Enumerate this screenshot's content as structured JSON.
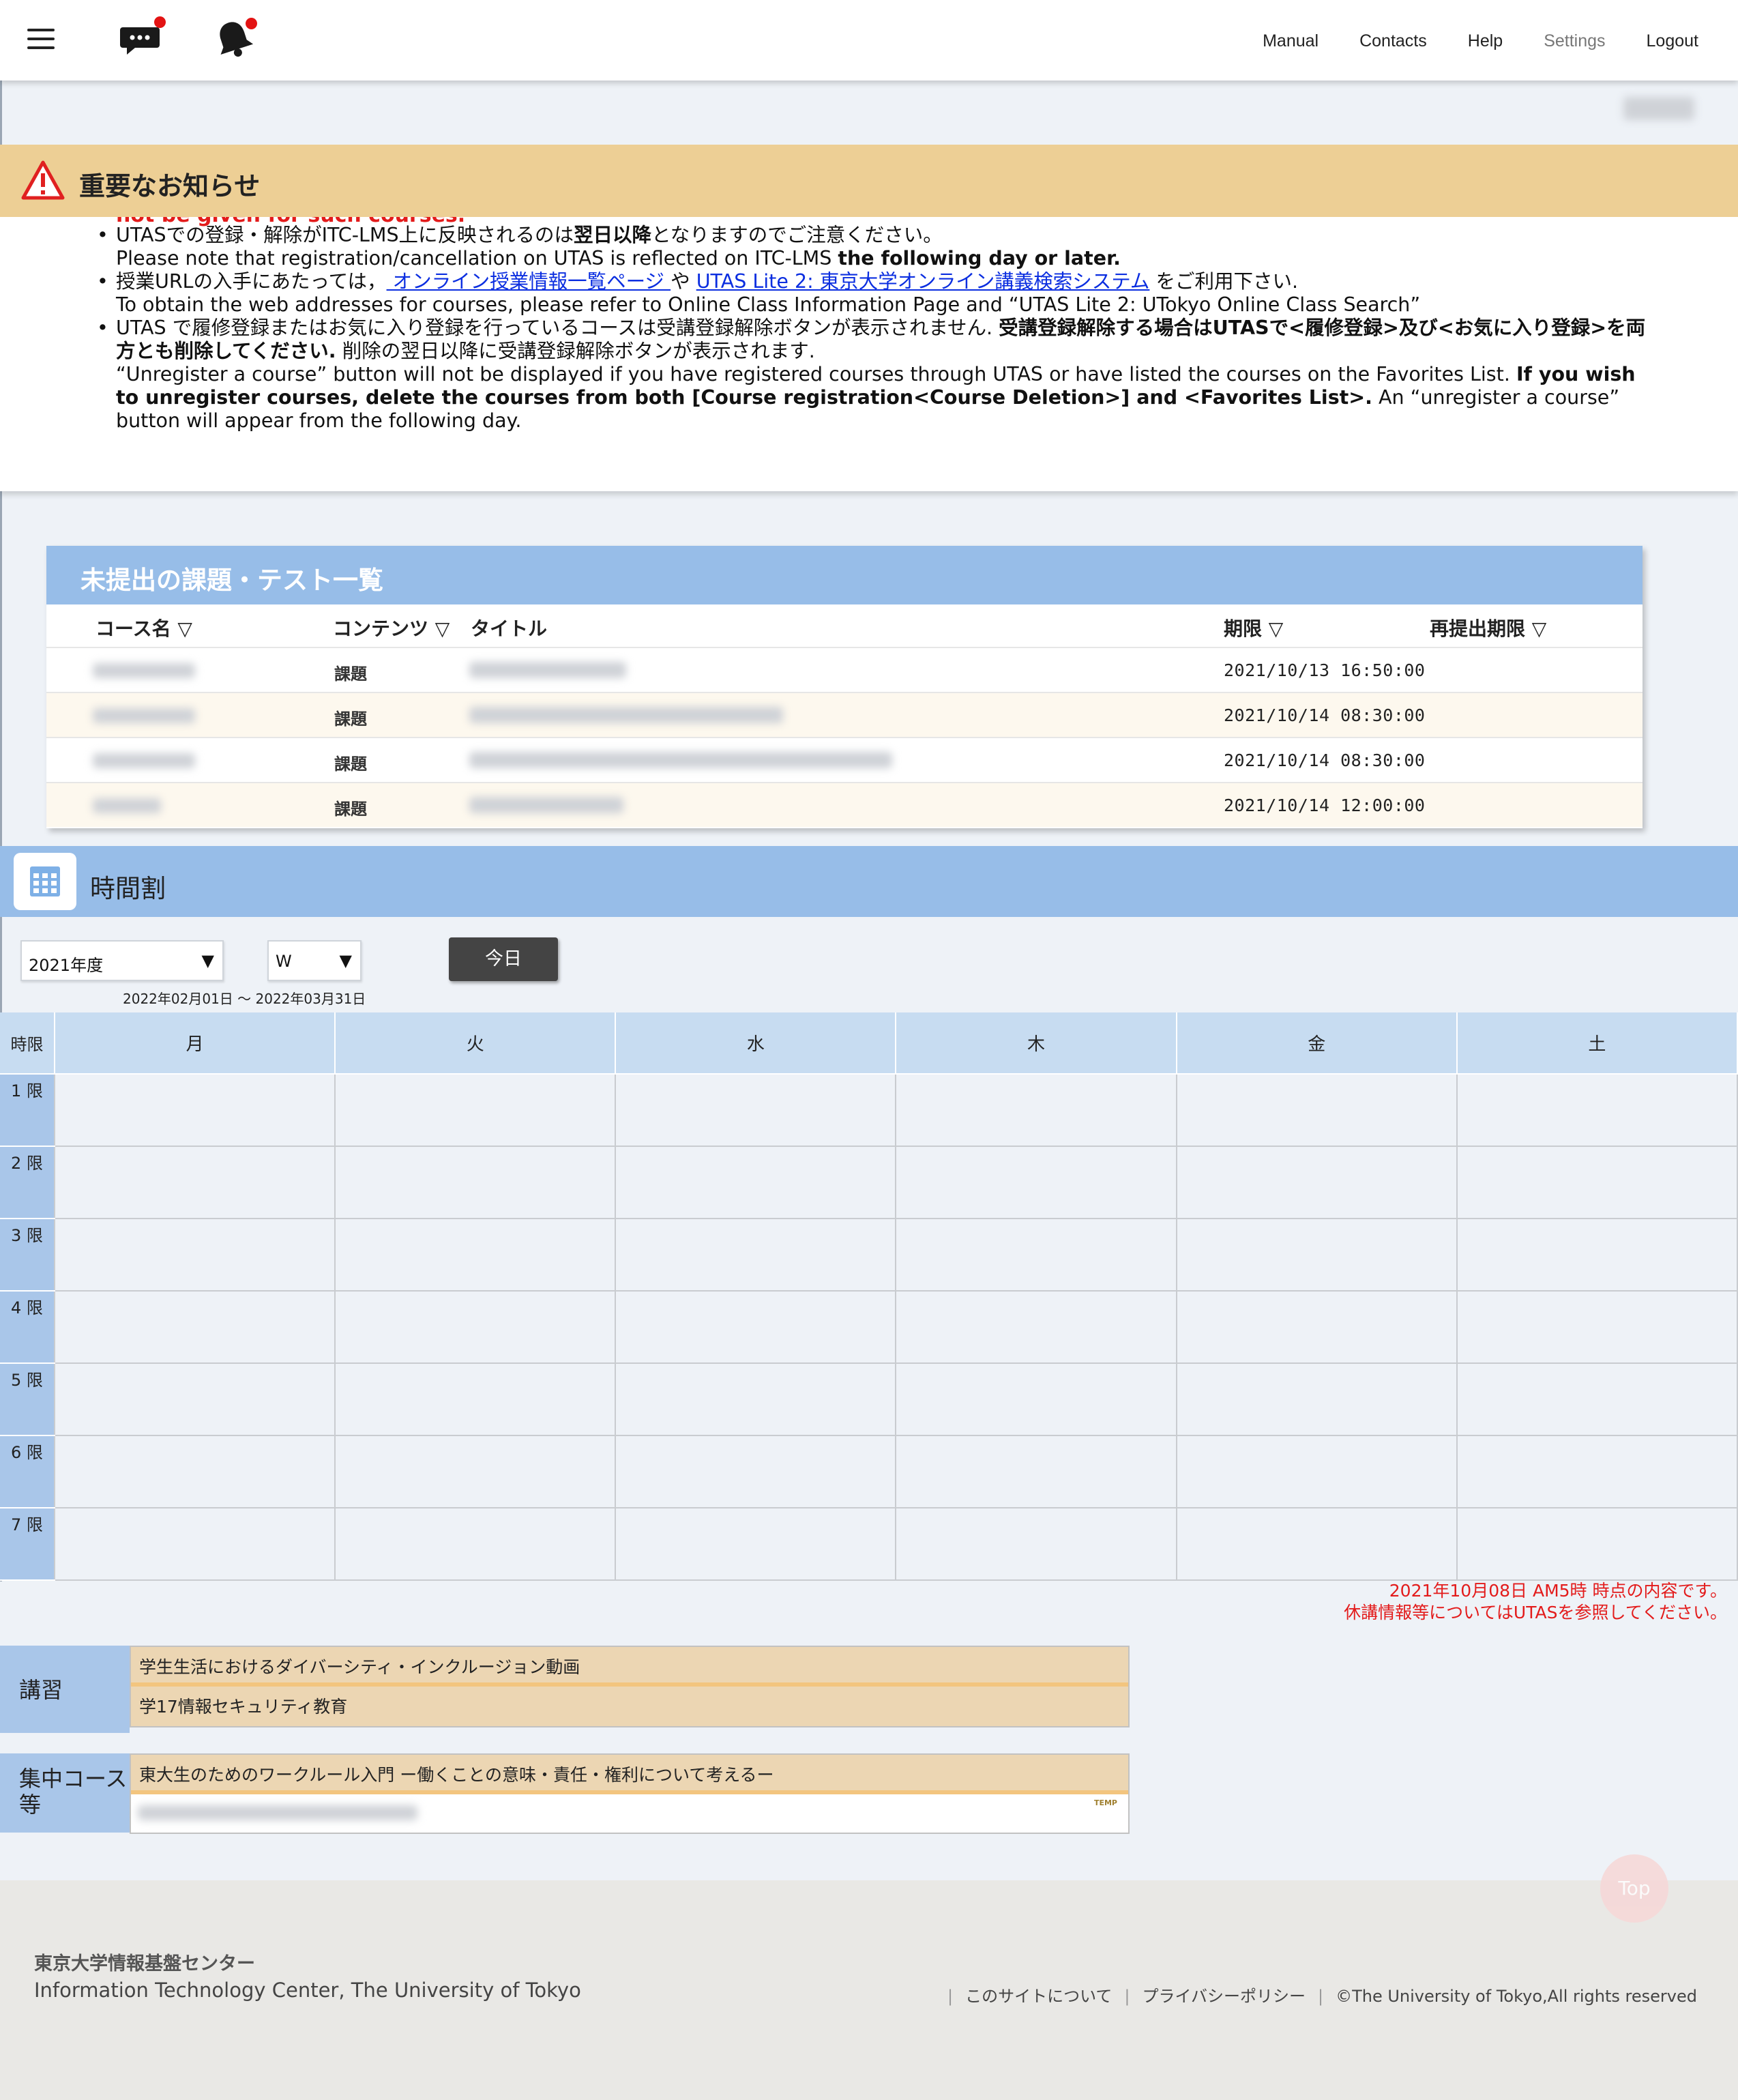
{
  "header": {
    "nav": {
      "manual": "Manual",
      "contacts": "Contacts",
      "help": "Help",
      "settings": "Settings",
      "logout": "Logout"
    }
  },
  "notice": {
    "title": "重要なお知らせ",
    "cut_text": "not be given for such courses.",
    "items": [
      {
        "ja_pre": "UTASでの登録・解除がITC-LMS上に反映されるのは",
        "ja_bold": "翌日以降",
        "ja_post": "となりますのでご注意ください。",
        "en_pre": "Please note that registration/cancellation on UTAS is reflected on ITC-LMS ",
        "en_bold": "the following day or later."
      },
      {
        "ja_pre": "授業URLの入手にあたっては，",
        "link1": " オンライン授業情報一覧ページ ",
        "ja_mid": "や",
        "link2": "UTAS Lite 2: 東京大学オンライン講義検索システム",
        "ja_post": " をご利用下さい.",
        "en": "To obtain the web addresses for courses, please refer to Online Class Information Page and “UTAS Lite 2: UTokyo Online Class Search”"
      },
      {
        "ja_pre": "UTAS で履修登録またはお気に入り登録を行っているコースは受講登録解除ボタンが表示されません.",
        "ja_bold": "受講登録解除する場合はUTASで<履修登録>及び<お気に入り登録>を両方とも削除してください.",
        "ja_post": "削除の翌日以降に受講登録解除ボタンが表示されます.",
        "en_pre": "“Unregister a course” button will not be displayed if you have registered courses through UTAS or have listed the courses on the Favorites List. ",
        "en_bold": "If you wish to unregister courses, delete the courses from both [Course registration<Course Deletion>] and <Favorites List>.",
        "en_post": " An “unregister a course” button will appear from the following day."
      }
    ]
  },
  "assignments": {
    "title": "未提出の課題・テスト一覧",
    "headers": {
      "course": "コース名 ▽",
      "contents": "コンテンツ ▽",
      "title": "タイトル",
      "deadline": "期限 ▽",
      "resubmit": "再提出期限 ▽"
    },
    "rows": [
      {
        "type": "課題",
        "deadline": "2021/10/13 16:50:00"
      },
      {
        "type": "課題",
        "deadline": "2021/10/14 08:30:00"
      },
      {
        "type": "課題",
        "deadline": "2021/10/14 08:30:00"
      },
      {
        "type": "課題",
        "deadline": "2021/10/14 12:00:00"
      }
    ]
  },
  "timetable": {
    "title": "時間割",
    "year": "2021年度",
    "term": "W",
    "today_button": "今日",
    "range": "2022年02月01日 〜 2022年03月31日",
    "period_header": "時限",
    "days": [
      "月",
      "火",
      "水",
      "木",
      "金",
      "土"
    ],
    "periods": [
      "1 限",
      "2 限",
      "3 限",
      "4 限",
      "5 限",
      "6 限",
      "7 限"
    ],
    "note_line1": "2021年10月08日 AM5時 時点の内容です。",
    "note_line2": "休講情報等についてはUTASを参照してください。"
  },
  "lectures": {
    "label": "講習",
    "items": [
      "学生生活におけるダイバーシティ・インクルージョン動画",
      "学17情報セキュリティ教育"
    ]
  },
  "intensive": {
    "label": "集中コース等",
    "items": [
      "東大生のためのワークルール入門 ー働くことの意味・責任・権利について考えるー"
    ],
    "temp_badge": "TEMP"
  },
  "top_button": "Top",
  "footer": {
    "org_ja": "東京大学情報基盤センター",
    "org_en": "Information Technology Center, The University of Tokyo",
    "about": "このサイトについて",
    "privacy": "プライバシーポリシー",
    "copyright": "©The University of Tokyo,All rights reserved"
  },
  "colors": {
    "accent_blue": "#97bde8",
    "notice_bg": "#edcf95",
    "alert_red": "#e31b1b",
    "link_blue": "#0b2ee0"
  }
}
